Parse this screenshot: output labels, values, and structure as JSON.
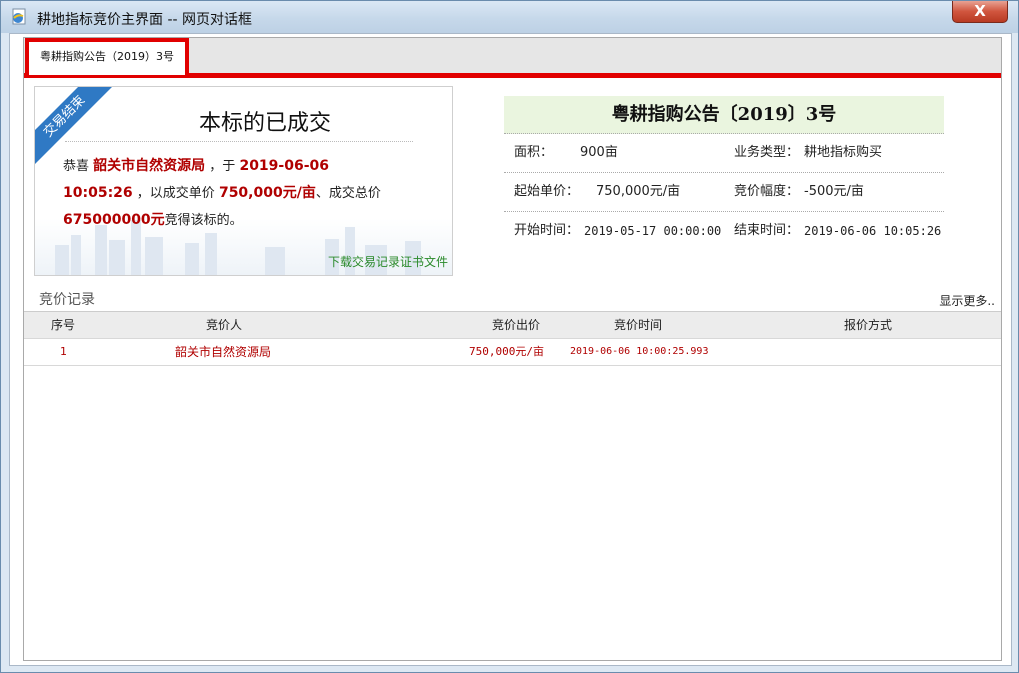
{
  "window": {
    "title": "耕地指标竞价主界面 -- 网页对话框",
    "close_label": "X"
  },
  "tab": {
    "label": "粤耕指购公告（2019）3号"
  },
  "result": {
    "ribbon": "交易结束",
    "title": "本标的已成交",
    "congrats": "恭喜",
    "winner": "韶关市自然资源局",
    "at": "，于",
    "date": "2019-06-06",
    "time": "10:05:26",
    "unit_price_prefix": "，以成交单价",
    "unit_price": "750,000元/亩",
    "total_prefix": "、成交总价",
    "total": "675000000元",
    "suffix": "竞得该标的。",
    "download": "下载交易记录证书文件"
  },
  "info": {
    "title": "粤耕指购公告〔2019〕3号",
    "area_label": "面积：",
    "area_value": "900亩",
    "type_label": "业务类型：",
    "type_value": "耕地指标购买",
    "start_price_label": "起始单价：",
    "start_price_value": "750,000元/亩",
    "step_label": "竞价幅度：",
    "step_value": "-500元/亩",
    "start_time_label": "开始时间：",
    "start_time_value": "2019-05-17 00:00:00",
    "end_time_label": "结束时间：",
    "end_time_value": "2019-06-06 10:05:26"
  },
  "records": {
    "title": "竞价记录",
    "more": "显示更多..",
    "columns": [
      "序号",
      "竞价人",
      "竞价出价",
      "竞价时间",
      "报价方式"
    ],
    "rows": [
      [
        "1",
        "韶关市自然资源局",
        "750,000元/亩",
        "2019-06-06 10:00:25.993",
        ""
      ]
    ]
  },
  "colors": {
    "accent_red": "#e10000",
    "value_red": "#b00000",
    "ribbon_blue": "#2f79c4",
    "link_green": "#2a8a2a"
  }
}
